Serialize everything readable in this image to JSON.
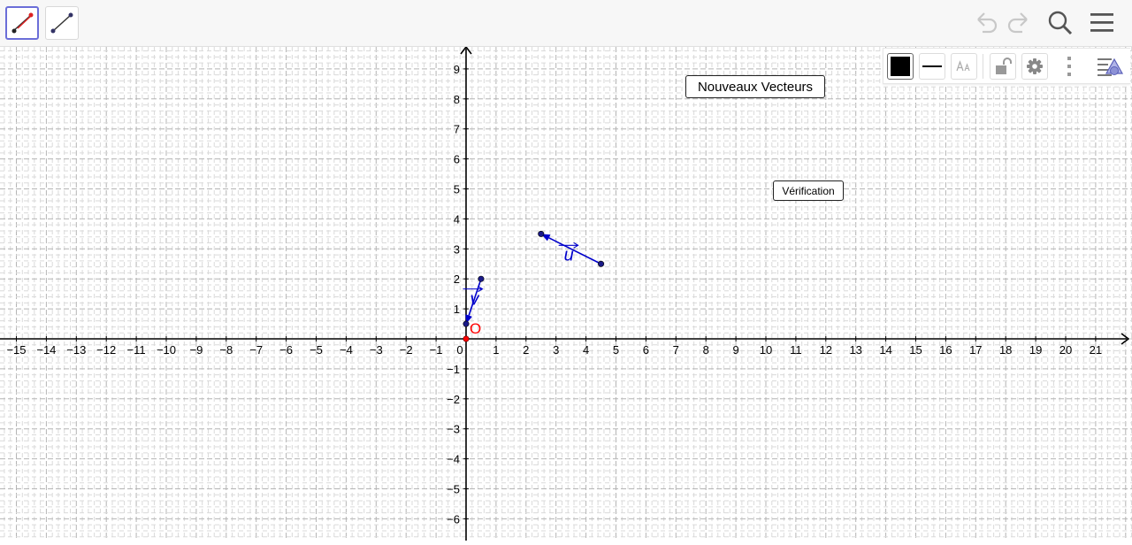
{
  "toolbar": {
    "tools": [
      {
        "icon": "vector-tool-icon",
        "selected": true
      },
      {
        "icon": "segment-tool-icon",
        "selected": false
      }
    ],
    "right_icons": [
      "undo-icon",
      "redo-icon",
      "search-icon",
      "menu-icon"
    ]
  },
  "stylebar": {
    "color_value": "#000000",
    "buttons": [
      "color-swatch-icon",
      "line-style-icon",
      "text-size-icon",
      "lock-icon",
      "settings-gear-icon",
      "more-options-icon",
      "toggle-stylebar-icon"
    ]
  },
  "canvas": {
    "x_range": [
      -15,
      21
    ],
    "y_range": [
      -6,
      9
    ],
    "grid": "dashed minor/major grid",
    "x_ticks": [
      "−15",
      "−14",
      "−13",
      "−12",
      "−11",
      "−10",
      "−9",
      "−8",
      "−7",
      "−6",
      "−5",
      "−4",
      "−3",
      "−2",
      "−1",
      "0",
      "1",
      "2",
      "3",
      "4",
      "5",
      "6",
      "7",
      "8",
      "9",
      "10",
      "11",
      "12",
      "13",
      "14",
      "15",
      "16",
      "17",
      "18",
      "19",
      "20",
      "21"
    ],
    "y_ticks": [
      "9",
      "8",
      "7",
      "6",
      "5",
      "4",
      "3",
      "2",
      "1",
      "−1",
      "−2",
      "−3",
      "−4",
      "−5",
      "−6"
    ],
    "origin_label": "O",
    "origin_color": "#ff0000",
    "vector_color": "#0000cc",
    "vectors": [
      {
        "label": "v",
        "from": [
          0.5,
          2.0
        ],
        "to": [
          0.0,
          0.5
        ],
        "mid_point": [
          0.0,
          0.5
        ]
      },
      {
        "label": "u",
        "from": [
          4.5,
          2.5
        ],
        "to": [
          2.5,
          3.5
        ]
      }
    ],
    "points": [
      [
        0.0,
        0.5
      ],
      [
        0.5,
        2.0
      ],
      [
        2.5,
        3.5
      ],
      [
        4.5,
        2.5
      ]
    ]
  },
  "buttons": {
    "new_vectors": "Nouveaux Vecteurs",
    "verification": "Vérification"
  }
}
